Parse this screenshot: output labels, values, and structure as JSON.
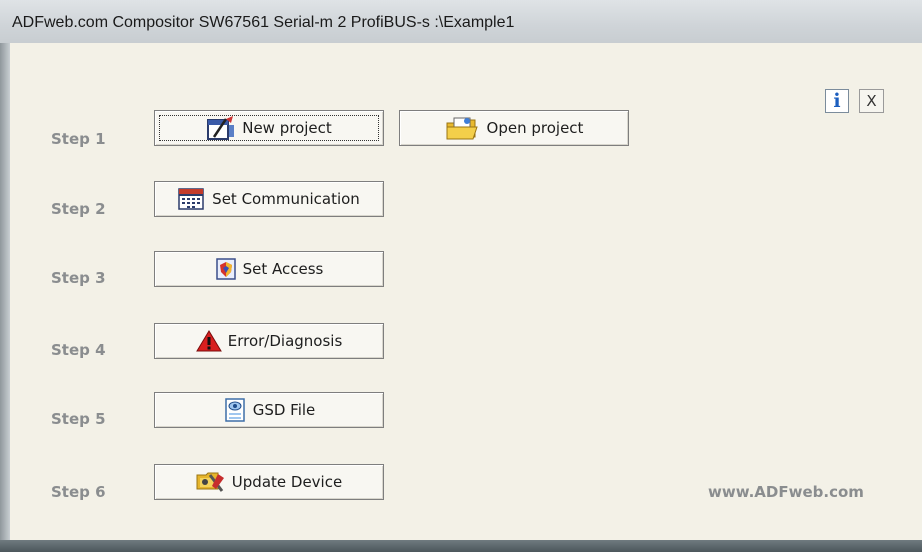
{
  "window": {
    "title": "ADFweb.com Compositor SW67561 Serial-m 2 ProfiBUS-s :\\Example1"
  },
  "toolbar": {
    "info_label": "i",
    "close_label": "X"
  },
  "steps": [
    {
      "label": "Step 1"
    },
    {
      "label": "Step 2"
    },
    {
      "label": "Step 3"
    },
    {
      "label": "Step 4"
    },
    {
      "label": "Step 5"
    },
    {
      "label": "Step 6"
    }
  ],
  "buttons": {
    "new_project": "New project",
    "open_project": "Open project",
    "set_communication": "Set Communication",
    "set_access": "Set Access",
    "error_diagnosis": "Error/Diagnosis",
    "gsd_file": "GSD File",
    "update_device": "Update Device"
  },
  "footer": {
    "website": "www.ADFweb.com"
  },
  "icons": {
    "new_project": "new-project-icon",
    "open_project": "folder-icon",
    "set_communication": "communication-table-icon",
    "set_access": "access-shield-icon",
    "error_diagnosis": "warning-icon",
    "gsd_file": "gsd-file-icon",
    "update_device": "update-tools-icon"
  }
}
